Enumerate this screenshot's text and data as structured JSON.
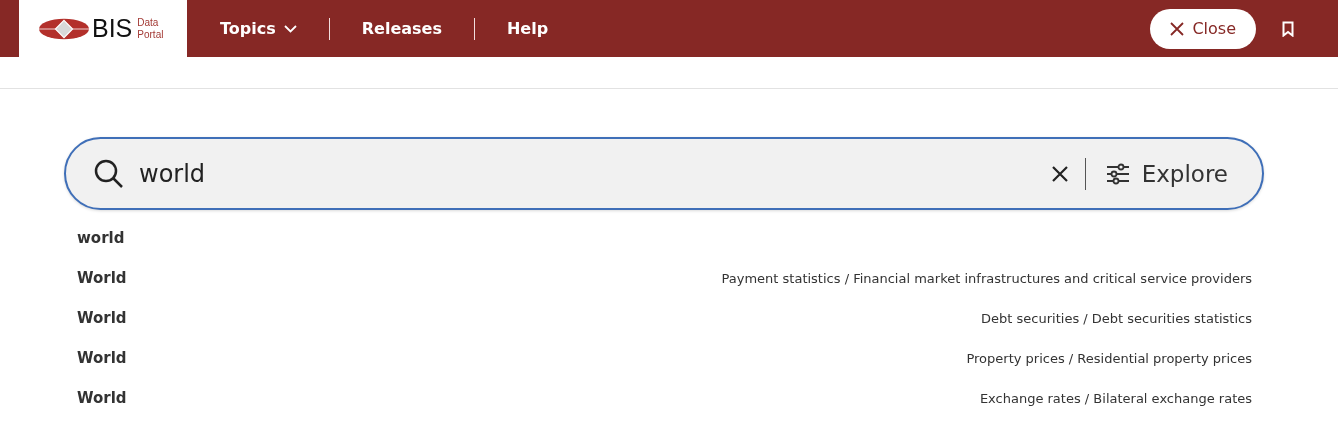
{
  "header": {
    "logo": {
      "mark": "BIS",
      "line1": "Data",
      "line2": "Portal"
    },
    "nav": [
      {
        "label": "Topics",
        "dropdown": true
      },
      {
        "label": "Releases",
        "dropdown": false
      },
      {
        "label": "Help",
        "dropdown": false
      }
    ],
    "close_button": "Close"
  },
  "search": {
    "value": "world",
    "action": "Explore"
  },
  "suggestions": [
    {
      "term": "world"
    },
    {
      "term": "World",
      "path": "Payment statistics / Financial market infrastructures and critical service providers"
    },
    {
      "term": "World",
      "path": "Debt securities / Debt securities statistics"
    },
    {
      "term": "World",
      "path": "Property prices / Residential property prices"
    },
    {
      "term": "World",
      "path": "Exchange rates / Bilateral exchange rates"
    }
  ]
}
